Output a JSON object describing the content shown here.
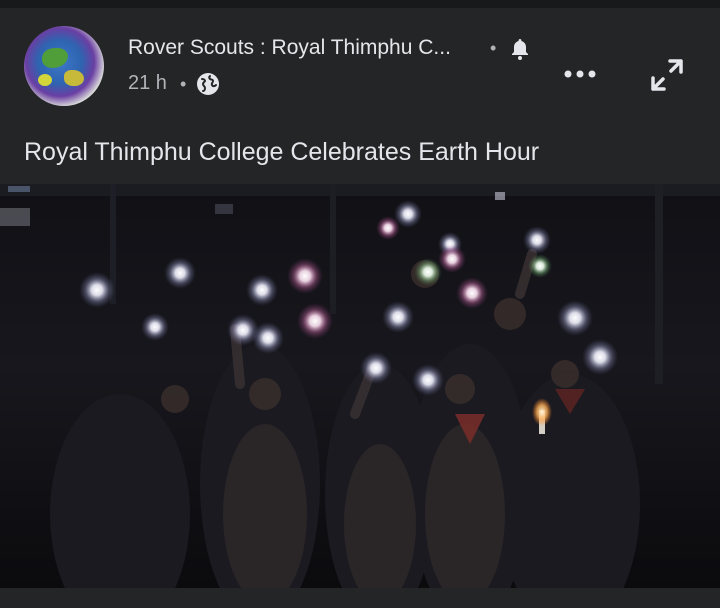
{
  "post": {
    "page_name": "Rover Scouts : Royal Thimphu C...",
    "timestamp": "21 h",
    "caption": "Royal Thimphu College Celebrates Earth Hour"
  },
  "icons": {
    "avatar": "globe-avatar",
    "notify": "bell-icon",
    "audience": "globe-icon",
    "more": "more-icon",
    "expand": "expand-icon"
  },
  "colors": {
    "background": "#242526",
    "text_primary": "#e4e6eb",
    "text_secondary": "#b0b3b8",
    "media_background": "#0d0d10"
  }
}
